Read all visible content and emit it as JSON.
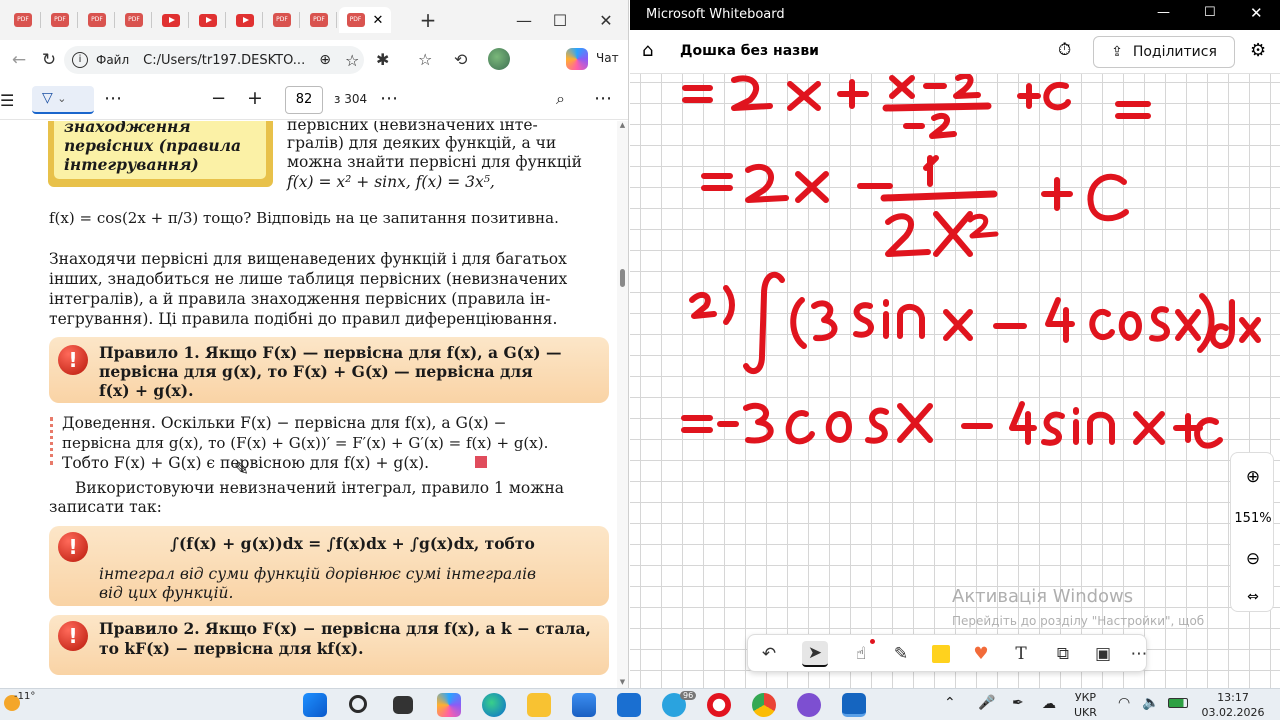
{
  "browser": {
    "tab_labels": [
      "PDF",
      "PDF",
      "PDF",
      "PDF",
      "PDF",
      "PDF",
      "PDF",
      "PDF",
      "PDF"
    ],
    "address": {
      "file_label": "Файл",
      "url": "C:/Users/tr197.DESKTO..."
    },
    "copilot_label": "Чат",
    "pdf": {
      "page": "82",
      "of_pages": "з 304"
    }
  },
  "document": {
    "box_heading_1": "знаходження",
    "box_heading_2": "первісних (правила",
    "box_heading_3": "інтегрування)",
    "intro_line_1": "первісних   (невизначених   інте-",
    "intro_line_2": "гралів) для деяких функцій, а чи",
    "intro_line_3": "можна знайти первісні для функцій",
    "intro_line_4": "f(x) = x² + sinx,  f(x) = 3x⁵,",
    "formula_line": "f(x) = cos(2x + π/3) тощо? Відповідь на це запитання позитивна.",
    "para1_l1": "Знаходячи первісні для вищенаведених функцій і для багатьох",
    "para1_l2": "інших, знадобиться не лише таблиця первісних (невизначених",
    "para1_l3": "інтегралів), а й правила знаходження первісних (правила ін-",
    "para1_l4": "тегрування). Ці правила подібні до правил диференціювання.",
    "rule1_l1": "Правило 1. Якщо F(x) — первісна для f(x), а G(x) —",
    "rule1_l2": "первісна для g(x), то F(x) + G(x) — первісна для",
    "rule1_l3": "f(x) + g(x).",
    "proof_l1": "Доведення. Оскільки F(x) − первісна для f(x), а G(x) −",
    "proof_l2": "первісна для g(x), то (F(x) + G(x))′ = F′(x) + G′(x) = f(x) + g(x).",
    "proof_l3": "Тобто F(x) + G(x) є первісною для f(x) + g(x).",
    "para2_l1": "Використовуючи невизначений інтеграл, правило 1 можна",
    "para2_l2": "записати так:",
    "rule_int_l1": "∫(f(x) + g(x))dx = ∫f(x)dx + ∫g(x)dx, тобто",
    "rule_int_l2": "інтеграл від суми функцій дорівнює сумі інтегралів",
    "rule_int_l3": "від цих функцій.",
    "rule2_l1": "Правило 2. Якщо F(x) − первісна для f(x), а k − стала,",
    "rule2_l2": "то kF(x) − первісна для kf(x)."
  },
  "whiteboard": {
    "app_title": "Microsoft Whiteboard",
    "board_name": "Дошка без назви",
    "share_label": "Поділитися",
    "zoom": "151%",
    "activation_title": "Активація Windows",
    "activation_l1": "Перейдіть до розділу \"Настройки\", щоб",
    "activation_l2": "активувати Windows",
    "ink_color": "#e0141e"
  },
  "taskbar": {
    "weather": "-11°",
    "lang_1": "УКР",
    "lang_2": "UKR",
    "time": "13:17",
    "date": "03.02.2026",
    "badge": "96"
  }
}
